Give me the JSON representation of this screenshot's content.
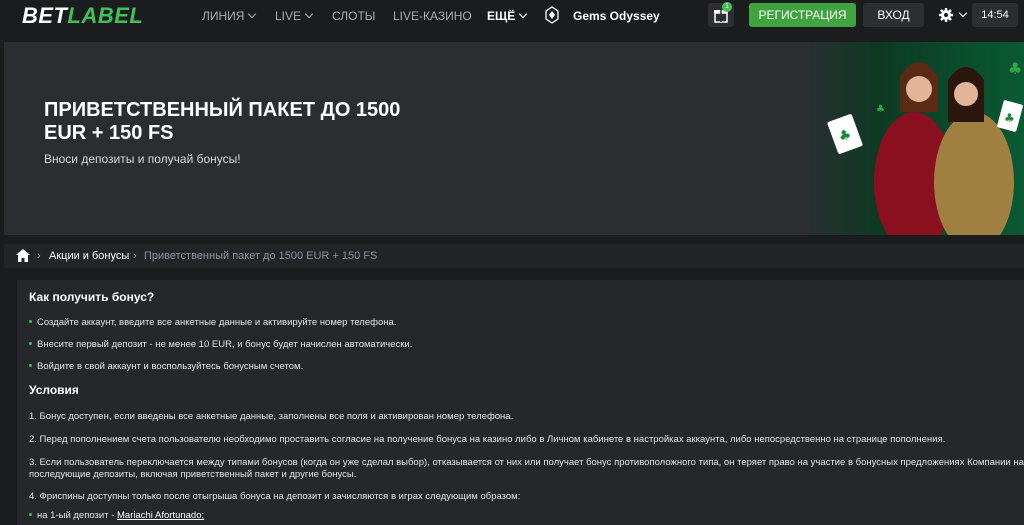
{
  "header": {
    "logo_part1": "BET",
    "logo_part2": "LABEL",
    "nav": [
      {
        "label": "ЛИНИЯ"
      },
      {
        "label": "LIVE"
      },
      {
        "label": "СЛОТЫ"
      },
      {
        "label": "LIVE-КАЗИНО"
      },
      {
        "label": "ЕЩЁ"
      }
    ],
    "featured_game": "Gems Odyssey",
    "gift_badge": "1",
    "register_label": "РЕГИСТРАЦИЯ",
    "login_label": "ВХОД",
    "time": "14:54"
  },
  "banner": {
    "title": "ПРИВЕТСТВЕННЫЙ ПАКЕТ ДО 1500 EUR + 150 FS",
    "subtitle": "Вноси депозиты и получай бонусы!"
  },
  "breadcrumb": {
    "section": "Акции и бонусы",
    "current": "Приветственный пакет до 1500 EUR + 150 FS"
  },
  "content": {
    "how_title": "Как получить бонус?",
    "steps": [
      "Создайте аккаунт, введите все анкетные данные и активируйте номер телефона.",
      "Внесите первый депозит - не менее 10 EUR, и бонус будет начислен автоматически.",
      "Войдите в свой аккаунт и воспользуйтесь бонусным счетом."
    ],
    "terms_title": "Условия",
    "terms": [
      "1. Бонус доступен, если введены все анкетные данные, заполнены все поля и активирован номер телефона.",
      "2. Перед пополнением счета пользователю необходимо проставить согласие на получение бонуса на казино либо в Личном кабинете в настройках аккаунта, либо непосредственно на странице пополнения.",
      "3. Если пользователь переключается между типами бонусов (когда он уже сделал выбор), отказывается от них или получает бонус противоположного типа, он теряет право на участие в бонусных предложениях Компании на последующие депозиты, включая приветственный пакет и другие бонусы.",
      "4. Фриспины доступны только после отыгрыша бонуса на депозит и зачисляются в играх следующим образом:"
    ],
    "deposit1_prefix": "на 1-ый депозит - ",
    "deposit1_game": "Mariachi Afortunado;"
  }
}
